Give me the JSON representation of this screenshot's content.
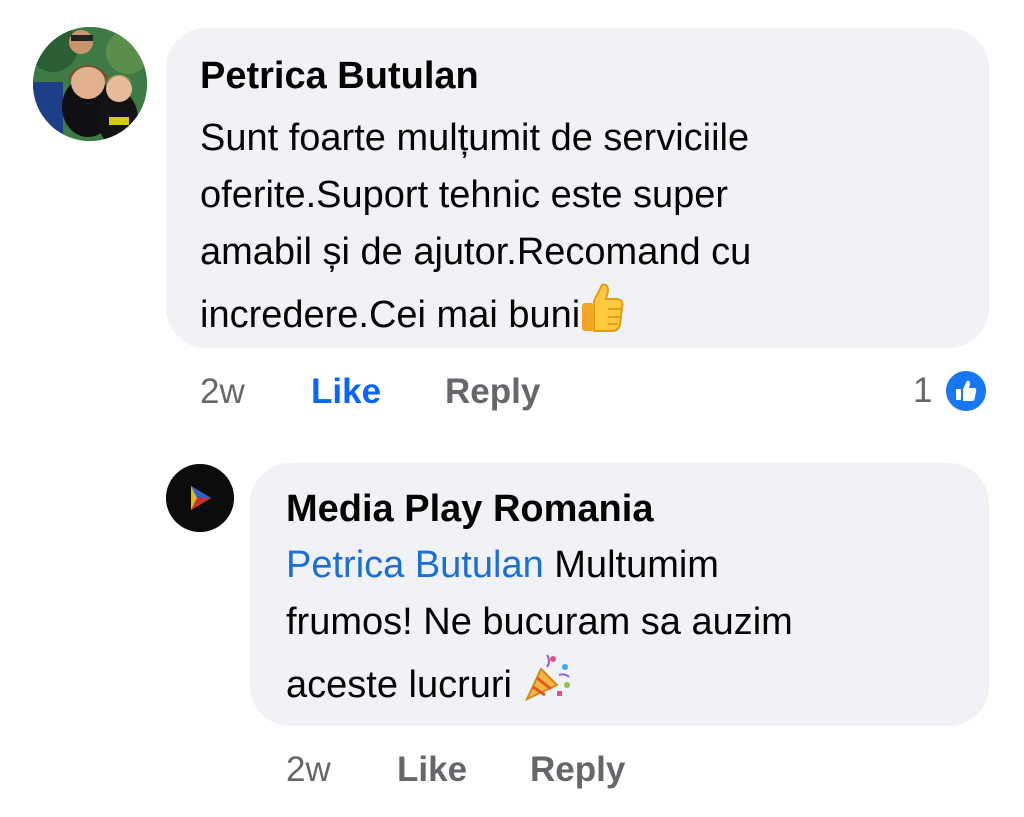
{
  "comment": {
    "author": "Petrica Butulan",
    "lines": [
      "Sunt foarte mulțumit de serviciile",
      "oferite.Suport tehnic este super",
      "amabil și de ajutor.Recomand cu",
      "incredere.Cei mai buni"
    ],
    "emoji": "thumbs-up",
    "time": "2w",
    "like_label": "Like",
    "reply_label": "Reply",
    "reaction_count": "1",
    "reaction_icon": "like-reaction",
    "like_active": true
  },
  "reply": {
    "author": "Media Play Romania",
    "mention": "Petrica Butulan",
    "line1": "Multumim",
    "line2": "frumos! Ne bucuram sa auzim",
    "line3": "aceste lucruri",
    "emoji": "party-popper",
    "time": "2w",
    "like_label": "Like",
    "reply_label": "Reply"
  },
  "colors": {
    "bubble": "#f0f2f5",
    "link": "#1a6ed8",
    "like_active": "#0866ff",
    "meta": "#65676b"
  }
}
